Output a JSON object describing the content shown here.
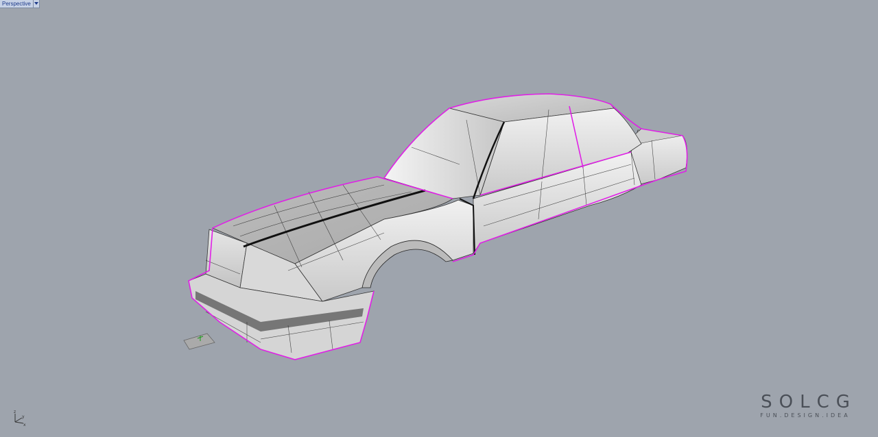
{
  "viewport": {
    "title": "Perspective",
    "menu_icon": "triangle-down-icon",
    "background_color": "#9ea4ad",
    "curve_highlight_color": "#e020e6",
    "surface_color": "#e9e9e9"
  },
  "axis_widget": {
    "labels": [
      "z",
      "y",
      "x"
    ]
  },
  "watermark": {
    "main": "SOLCG",
    "sub": "FUN.DESIGN.IDEA"
  }
}
